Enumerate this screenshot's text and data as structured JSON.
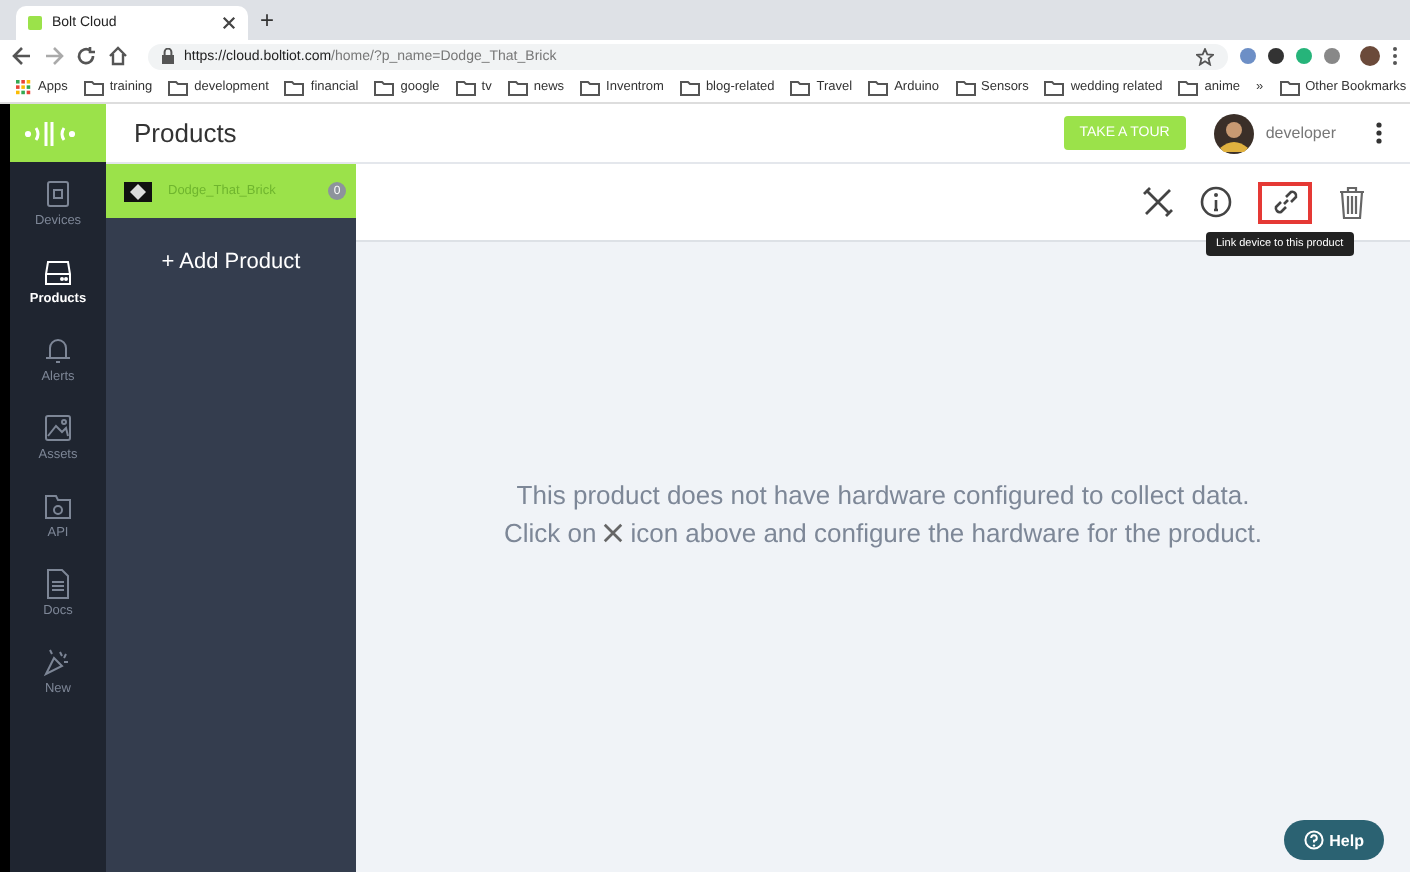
{
  "browser": {
    "tab_title": "Bolt Cloud",
    "new_tab": "+",
    "url_domain": "https://cloud.boltiot.com",
    "url_path": "/home/?p_name=Dodge_That_Brick",
    "bookmarks": [
      {
        "label": "Apps",
        "kind": "apps"
      },
      {
        "label": "training",
        "kind": "folder"
      },
      {
        "label": "development",
        "kind": "folder"
      },
      {
        "label": "financial",
        "kind": "folder"
      },
      {
        "label": "google",
        "kind": "folder"
      },
      {
        "label": "tv",
        "kind": "folder"
      },
      {
        "label": "news",
        "kind": "folder"
      },
      {
        "label": "Inventrom",
        "kind": "folder"
      },
      {
        "label": "blog-related",
        "kind": "folder"
      },
      {
        "label": "Travel",
        "kind": "folder"
      },
      {
        "label": "Arduino",
        "kind": "folder"
      },
      {
        "label": "Sensors",
        "kind": "folder"
      },
      {
        "label": "wedding related",
        "kind": "folder"
      },
      {
        "label": "anime",
        "kind": "folder"
      }
    ],
    "more_bookmarks": "»",
    "other_bookmarks": "Other Bookmarks"
  },
  "header": {
    "title": "Products",
    "tour_button": "TAKE A TOUR",
    "user": "developer"
  },
  "sidebar": {
    "items": [
      {
        "label": "Devices",
        "kind": "devices",
        "selected": false
      },
      {
        "label": "Products",
        "kind": "products",
        "selected": true
      },
      {
        "label": "Alerts",
        "kind": "alerts",
        "selected": false
      },
      {
        "label": "Assets",
        "kind": "assets",
        "selected": false
      },
      {
        "label": "API",
        "kind": "api",
        "selected": false
      },
      {
        "label": "Docs",
        "kind": "docs",
        "selected": false
      },
      {
        "label": "New",
        "kind": "new",
        "selected": false
      }
    ]
  },
  "products": {
    "items": [
      {
        "name": "Dodge_That_Brick",
        "count": "0",
        "selected": true
      }
    ],
    "add_button": "+ Add Product"
  },
  "toolbar": {
    "tooltip": "Link device to this product"
  },
  "message": {
    "line1": "This product does not have hardware configured to collect data.",
    "line2_before": "Click on",
    "line2_after": "icon above and configure the hardware for the product."
  },
  "help_button": "Help"
}
